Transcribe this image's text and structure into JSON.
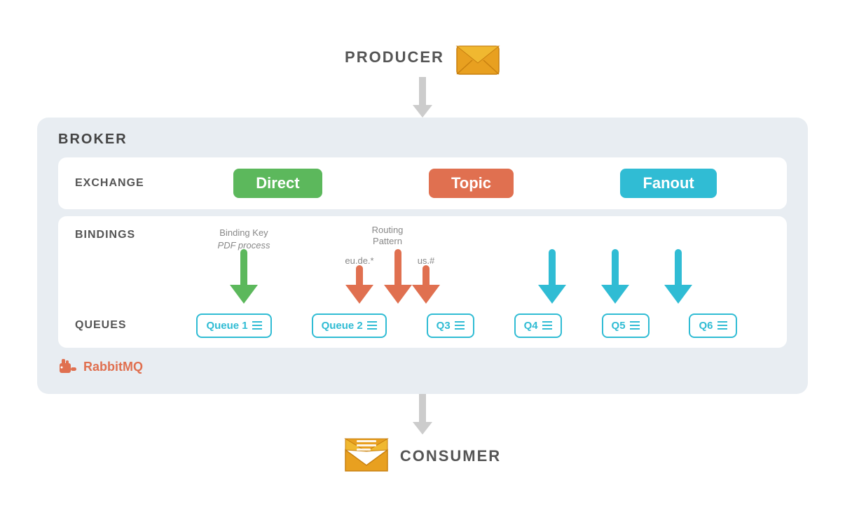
{
  "producer": {
    "label": "PRODUCER"
  },
  "broker": {
    "label": "BROKER",
    "exchange": {
      "label": "EXCHANGE",
      "types": [
        {
          "id": "direct",
          "name": "Direct",
          "color": "#5cb85c"
        },
        {
          "id": "topic",
          "name": "Topic",
          "color": "#e07050"
        },
        {
          "id": "fanout",
          "name": "Fanout",
          "color": "#30bcd4"
        }
      ]
    },
    "bindings": {
      "label": "BINDINGS",
      "direct_annotation1": "Binding Key",
      "direct_annotation2": "PDF process",
      "topic_annotation1": "Routing",
      "topic_annotation2": "Pattern",
      "topic_sub1": "eu.de.*",
      "topic_sub2": "us.#",
      "fanout_annotation": ""
    },
    "queues": {
      "label": "QUEUES",
      "items": [
        {
          "id": "q1",
          "name": "Queue 1"
        },
        {
          "id": "q2",
          "name": "Queue 2"
        },
        {
          "id": "q3",
          "name": "Q3"
        },
        {
          "id": "q4",
          "name": "Q4"
        },
        {
          "id": "q5",
          "name": "Q5"
        },
        {
          "id": "q6",
          "name": "Q6"
        }
      ]
    },
    "footer": "RabbitMQ"
  },
  "consumer": {
    "label": "CONSUMER"
  }
}
